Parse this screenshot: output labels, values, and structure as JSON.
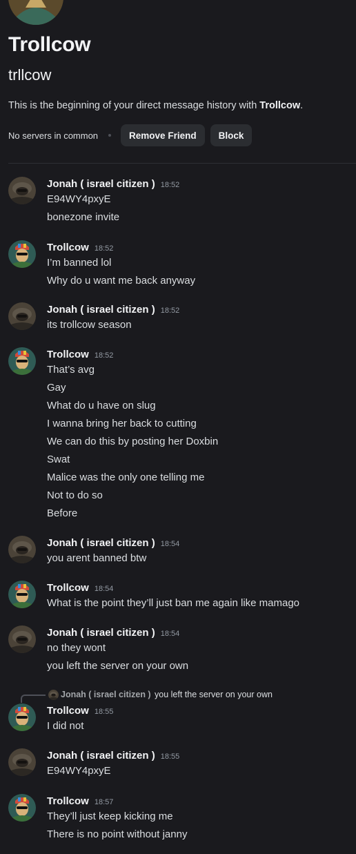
{
  "profile": {
    "display_name": "Trollcow",
    "username": "trllcow",
    "intro_prefix": "This is the beginning of your direct message history with ",
    "intro_name": "Trollcow",
    "intro_suffix": ".",
    "no_servers": "No servers in common",
    "remove_friend_label": "Remove Friend",
    "block_label": "Block"
  },
  "users": {
    "jonah": {
      "name": "Jonah ( israel citizen )",
      "avatar_icon": "jonah-avatar-icon"
    },
    "trollcow": {
      "name": "Trollcow",
      "avatar_icon": "trollcow-avatar-icon"
    }
  },
  "messages": [
    {
      "author": "Jonah ( israel citizen )",
      "time": "18:52",
      "lines": [
        "E94WY4pxyE",
        "bonezone invite"
      ]
    },
    {
      "author": "Trollcow",
      "time": "18:52",
      "lines": [
        "I’m banned lol",
        "Why do u want me back anyway"
      ]
    },
    {
      "author": "Jonah ( israel citizen )",
      "time": "18:52",
      "lines": [
        "its trollcow season"
      ]
    },
    {
      "author": "Trollcow",
      "time": "18:52",
      "lines": [
        "That’s avg",
        "Gay",
        "What do u have on slug",
        "I wanna bring her back to cutting",
        "We can do this by posting her Doxbin",
        "Swat",
        "Malice was the only one telling me",
        "Not to do so",
        "Before"
      ]
    },
    {
      "author": "Jonah ( israel citizen )",
      "time": "18:54",
      "lines": [
        "you arent banned btw"
      ]
    },
    {
      "author": "Trollcow",
      "time": "18:54",
      "lines": [
        "What is the point they’ll just ban me again like mamago"
      ]
    },
    {
      "author": "Jonah ( israel citizen )",
      "time": "18:54",
      "lines": [
        "no they wont",
        "you left the server on your own"
      ]
    },
    {
      "author": "Trollcow",
      "time": "18:55",
      "lines": [
        "I did not"
      ],
      "reply_to": {
        "author": "Jonah ( israel citizen )",
        "text": "you left the server on your own"
      }
    },
    {
      "author": "Jonah ( israel citizen )",
      "time": "18:55",
      "lines": [
        "E94WY4pxyE"
      ]
    },
    {
      "author": "Trollcow",
      "time": "18:57",
      "lines": [
        "They’ll just keep kicking me",
        "There is no point without janny"
      ]
    }
  ],
  "colors": {
    "background": "#1a1a1e",
    "button_bg": "#2b2d31",
    "timestamp": "#949ba4"
  }
}
